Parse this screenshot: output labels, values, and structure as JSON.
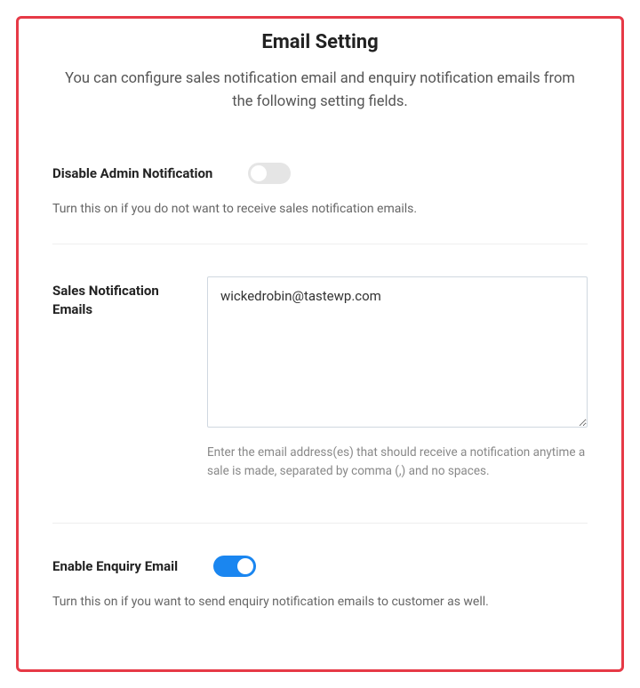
{
  "header": {
    "title": "Email Setting",
    "subtitle": "You can configure sales notification email and enquiry notification emails from the following setting fields."
  },
  "disable_admin": {
    "label": "Disable Admin Notification",
    "help": "Turn this on if you do not want to receive sales notification emails.",
    "state": "off"
  },
  "sales_emails": {
    "label": "Sales Notification Emails",
    "value": "wickedrobin@tastewp.com",
    "help": "Enter the email address(es) that should receive a notification anytime a sale is made, separated by comma (,) and no spaces."
  },
  "enable_enquiry": {
    "label": "Enable Enquiry Email",
    "help": "Turn this on if you want to send enquiry notification emails to customer as well.",
    "state": "on"
  },
  "colors": {
    "border": "#e63946",
    "toggle_on": "#1a86f0"
  }
}
